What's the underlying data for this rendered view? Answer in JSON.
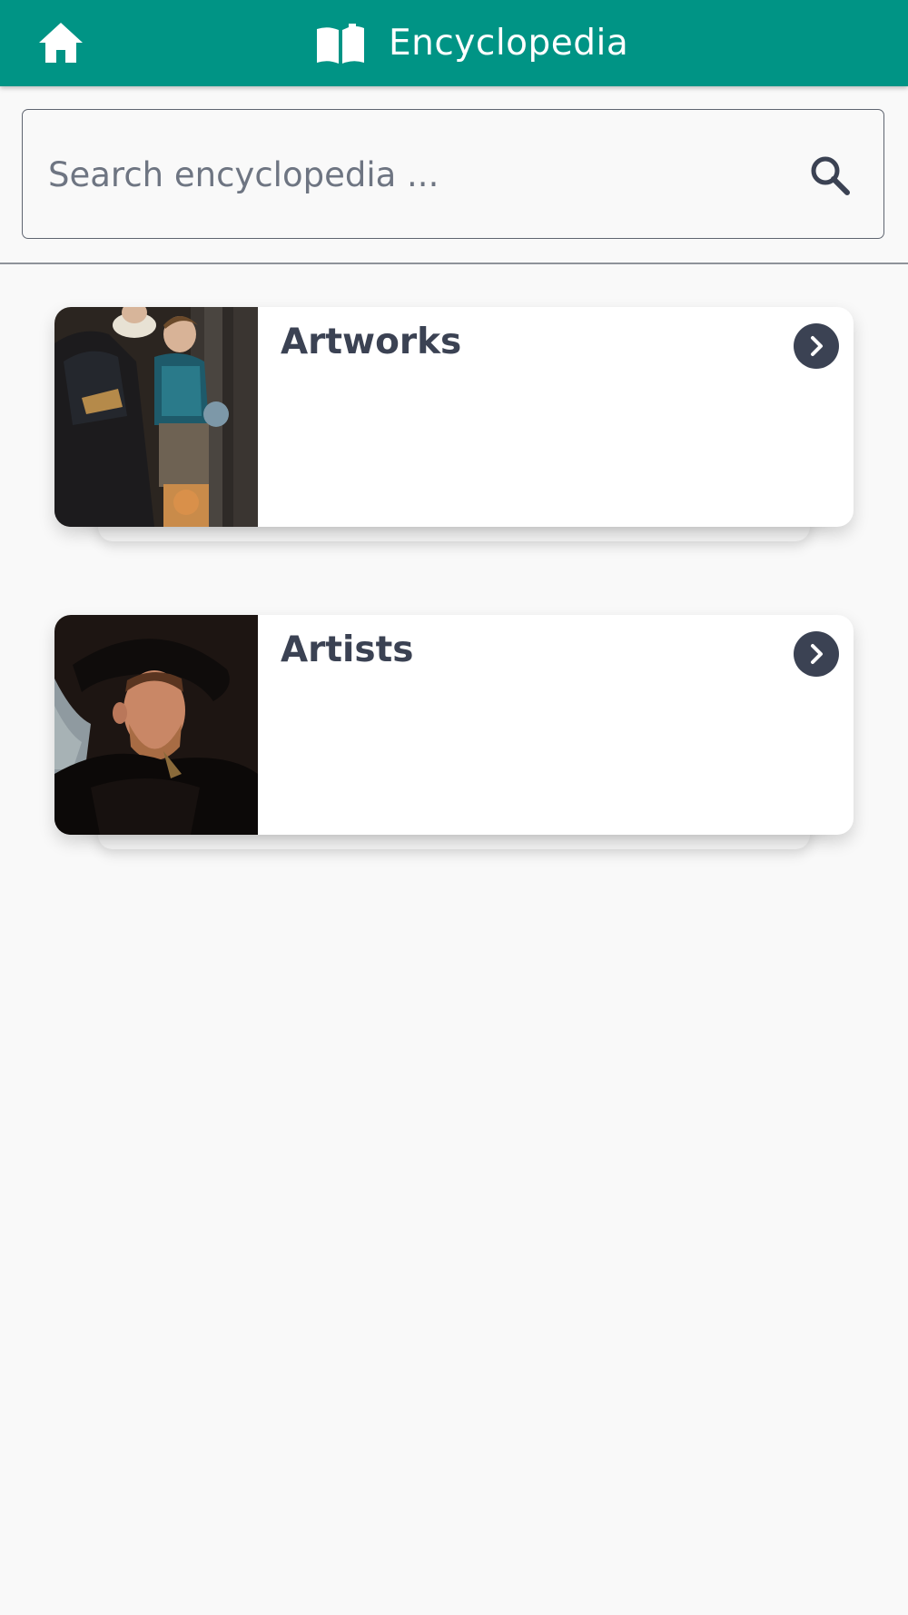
{
  "header": {
    "title": "Encyclopedia",
    "home_icon": "home-icon",
    "title_icon": "open-book-icon",
    "background": "#009485"
  },
  "search": {
    "placeholder": "Search encyclopedia ...",
    "value": "",
    "icon": "search-icon"
  },
  "categories": [
    {
      "title": "Artworks",
      "image": "painting-children-portrait",
      "action_icon": "chevron-right-icon"
    },
    {
      "title": "Artists",
      "image": "painting-man-in-hat-self-portrait",
      "action_icon": "chevron-right-icon"
    }
  ],
  "colors": {
    "accent": "#009485",
    "text_dark": "#3b4253",
    "background": "#f9f9f9"
  }
}
